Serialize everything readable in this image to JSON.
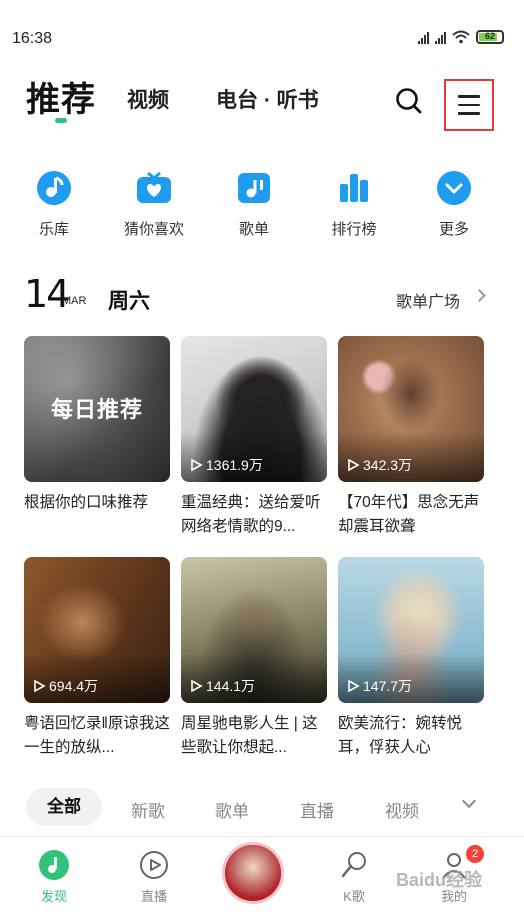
{
  "status_bar": {
    "time": "16:38",
    "battery": "62"
  },
  "top_nav": {
    "tabs": [
      {
        "label": "推荐"
      },
      {
        "label": "视频"
      },
      {
        "label": "电台 · 听书"
      }
    ],
    "search_icon": "search-icon",
    "menu_icon": "menu-icon",
    "accent": "#31c27c"
  },
  "quick_entries": [
    {
      "label": "乐库",
      "icon": "music-note-icon"
    },
    {
      "label": "猜你喜欢",
      "icon": "radio-heart-icon"
    },
    {
      "label": "歌单",
      "icon": "playlist-icon"
    },
    {
      "label": "排行榜",
      "icon": "ranking-icon"
    },
    {
      "label": "更多",
      "icon": "chevron-down-circle-icon"
    }
  ],
  "date_row": {
    "day": "14",
    "month": "MAR",
    "weekday": "周六",
    "link": "歌单广场"
  },
  "playlists": [
    {
      "title": "根据你的口味推荐",
      "overlay": "每日推荐",
      "plays": ""
    },
    {
      "title": "重温经典：送给爱听网络老情歌的9...",
      "plays": "1361.9万"
    },
    {
      "title": "【70年代】思念无声　却震耳欲聋",
      "plays": "342.3万"
    },
    {
      "title": "粤语回忆录‖原谅我这一生的放纵...",
      "plays": "694.4万"
    },
    {
      "title": "周星驰电影人生 | 这些歌让你想起...",
      "plays": "144.1万"
    },
    {
      "title": "欧美流行：婉转悦耳，俘获人心",
      "plays": "147.7万"
    }
  ],
  "categories": [
    "全部",
    "新歌",
    "歌单",
    "直播",
    "视频"
  ],
  "bottom_nav": {
    "items": [
      {
        "label": "发现",
        "icon": "discover-icon"
      },
      {
        "label": "直播",
        "icon": "live-play-icon"
      },
      {
        "label": "K歌",
        "icon": "karaoke-mic-icon"
      },
      {
        "label": "我的",
        "icon": "profile-icon"
      }
    ],
    "badge": "2"
  },
  "watermark": "Baidu经验"
}
